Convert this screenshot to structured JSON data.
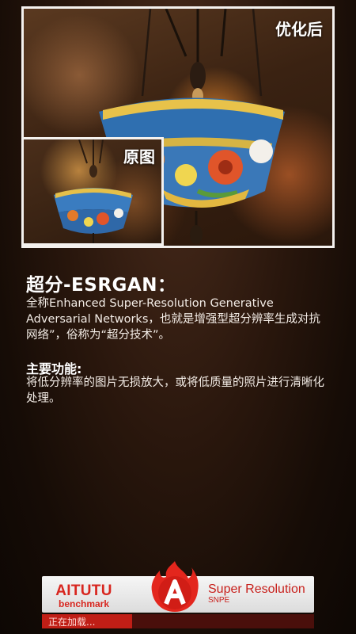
{
  "preview": {
    "after_label": "优化后",
    "before_label": "原图"
  },
  "content": {
    "title": "超分-ESRGAN：",
    "description": "全称Enhanced Super-Resolution Generative Adversarial Networks，也就是增强型超分辨率生成对抗网络”，俗称为“超分技术”。",
    "feature_heading": "主要功能:",
    "feature_text": "将低分辨率的图片无损放大，或将低质量的照片进行清晰化处理。"
  },
  "banner": {
    "brand_name": "AITUTU",
    "brand_sub": "benchmark",
    "product_name": "Super Resolution",
    "product_sub": "SNPE",
    "logo_icon": "flame-a-logo"
  },
  "progress": {
    "text": "正在加载...",
    "fraction": 0.33
  },
  "colors": {
    "accent_red": "#d8261f",
    "frame_border": "#f4f1ee"
  }
}
